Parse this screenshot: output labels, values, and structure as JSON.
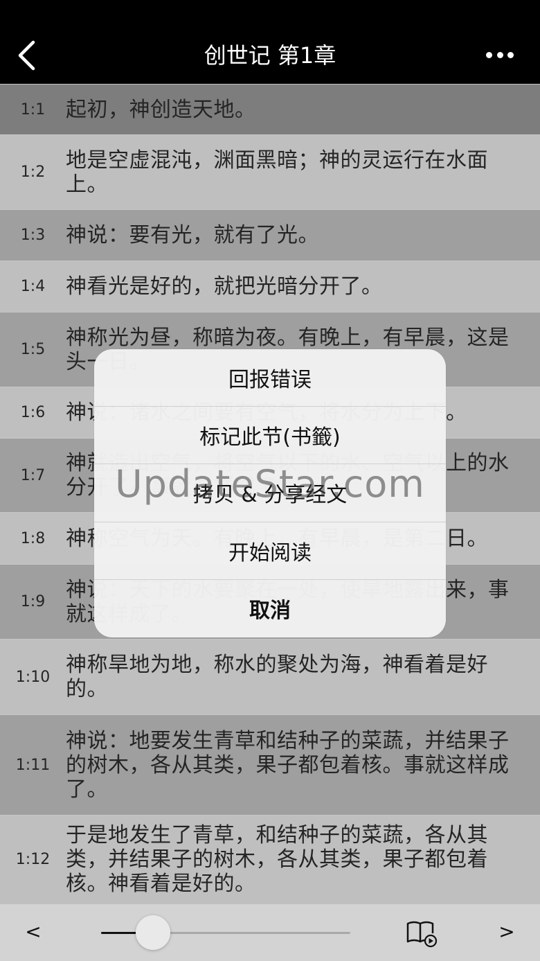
{
  "header": {
    "title": "创世记 第1章",
    "back_icon": "chevron-left-icon",
    "more_icon": "ellipsis-icon"
  },
  "verses": [
    {
      "num": "1:1",
      "text": "起初，神创造天地。"
    },
    {
      "num": "1:2",
      "text": "地是空虚混沌，渊面黑暗；神的灵运行在水面上。"
    },
    {
      "num": "1:3",
      "text": "神说：要有光，就有了光。"
    },
    {
      "num": "1:4",
      "text": "神看光是好的，就把光暗分开了。"
    },
    {
      "num": "1:5",
      "text": "神称光为昼，称暗为夜。有晚上，有早晨，这是头一日。"
    },
    {
      "num": "1:6",
      "text": "神说：诸水之间要有空气，将水分为上下。"
    },
    {
      "num": "1:7",
      "text": "神就造出空气，将空气以下的水、空气以上的水分开了。事就这样成了。"
    },
    {
      "num": "1:8",
      "text": "神称空气为天。有晚上，有早晨，是第二日。"
    },
    {
      "num": "1:9",
      "text": "神说：天下的水要聚在一处，使旱地露出来，事就这样成了。"
    },
    {
      "num": "1:10",
      "text": "神称旱地为地，称水的聚处为海，神看着是好的。"
    },
    {
      "num": "1:11",
      "text": "神说：地要发生青草和结种子的菜蔬，并结果子的树木，各从其类，果子都包着核。事就这样成了。"
    },
    {
      "num": "1:12",
      "text": "于是地发生了青草，和结种子的菜蔬，各从其类，并结果子的树木，各从其类，果子都包着核。神看着是好的。"
    }
  ],
  "action_sheet": {
    "items": [
      "回报错误",
      "标记此节(书籤)",
      "拷贝 & 分享经文",
      "开始阅读",
      "取消"
    ]
  },
  "watermark": "UpdateStar.com",
  "toolbar": {
    "prev_label": "<",
    "next_label": ">",
    "progress": 0.18,
    "book_icon": "book-play-icon"
  },
  "colors": {
    "row_dark": "#a6a6a6",
    "row_light": "#cecece",
    "row_highlight": "#7d7d7d"
  }
}
